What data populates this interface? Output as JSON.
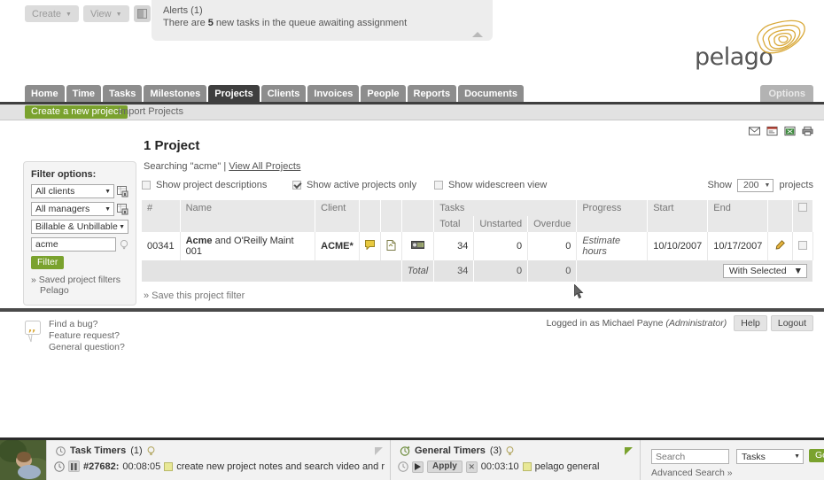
{
  "browser": {
    "create_label": "Create",
    "view_label": "View",
    "sidebar_toggle_icon": "panel-toggle-icon"
  },
  "alerts": {
    "title": "Alerts (1)",
    "message_prefix": "There are ",
    "count": "5",
    "message_suffix": " new tasks in the queue awaiting assignment",
    "collapse_icon": "collapse-triangle-icon"
  },
  "logo": {
    "text": "pelago",
    "mark_color": "#d9a93a"
  },
  "nav": {
    "tabs": [
      {
        "label": "Home",
        "active": false
      },
      {
        "label": "Time",
        "active": false
      },
      {
        "label": "Tasks",
        "active": false
      },
      {
        "label": "Milestones",
        "active": false
      },
      {
        "label": "Projects",
        "active": true
      },
      {
        "label": "Clients",
        "active": false
      },
      {
        "label": "Invoices",
        "active": false
      },
      {
        "label": "People",
        "active": false
      },
      {
        "label": "Reports",
        "active": false
      },
      {
        "label": "Documents",
        "active": false
      }
    ],
    "options_label": "Options"
  },
  "subnav": {
    "create_project_label": "Create a new project",
    "import_projects_label": "Import Projects"
  },
  "export_icons": [
    "email-icon",
    "report-icon",
    "excel-export-icon",
    "print-icon"
  ],
  "sidebar": {
    "title": "Filter options:",
    "client_select": "All clients",
    "manager_select": "All managers",
    "billable_select": "Billable & Unbillable",
    "text_filter_value": "acme",
    "text_filter_placeholder": "",
    "filter_button": "Filter",
    "saved_filters_label": "» Saved project filters",
    "saved_filter_items": [
      "Pelago"
    ]
  },
  "main": {
    "page_title": "1 Project",
    "searching_text": "Searching \"acme\"",
    "separator": "|",
    "view_all_link": "View All Projects",
    "checkboxes": [
      {
        "label": "Show project descriptions",
        "checked": false
      },
      {
        "label": "Show active projects only",
        "checked": true
      },
      {
        "label": "Show widescreen view",
        "checked": false
      }
    ],
    "show_label": "Show",
    "show_count": "200",
    "projects_label": "projects",
    "save_filter_link": "» Save this project filter",
    "with_selected_label": "With Selected"
  },
  "table": {
    "headers": {
      "id": "#",
      "name": "Name",
      "client": "Client",
      "tasks_group": "Tasks",
      "tasks_total": "Total",
      "tasks_unstarted": "Unstarted",
      "tasks_overdue": "Overdue",
      "progress": "Progress",
      "start": "Start",
      "end": "End"
    },
    "rows": [
      {
        "id": "00341",
        "name_bold": "Acme",
        "name_rest": " and O'Reilly Maint 001",
        "client": "ACME*",
        "icons": [
          "note-icon",
          "attach-file-icon",
          "presentation-icon"
        ],
        "tasks_total": "34",
        "tasks_unstarted": "0",
        "tasks_overdue": "0",
        "progress": "Estimate hours",
        "start": "10/10/2007",
        "end": "10/17/2007",
        "edit_icon": "pencil-edit-icon"
      }
    ],
    "total_row": {
      "label": "Total",
      "tasks_total": "34",
      "tasks_unstarted": "0",
      "tasks_overdue": "0"
    }
  },
  "footer": {
    "feedback_lines": [
      "Find a bug?",
      "Feature request?",
      "General question?"
    ],
    "logged_in_prefix": "Logged in as Michael Payne ",
    "logged_in_role": "(Administrator)",
    "help_label": "Help",
    "logout_label": "Logout"
  },
  "timerbar": {
    "task_timers": {
      "title": "Task Timers",
      "count": "(1)",
      "entry_id": "#27682:",
      "entry_time": "00:08:05",
      "entry_text": "create new project notes and search video and r"
    },
    "general_timers": {
      "title": "General Timers",
      "count": "(3)",
      "apply_label": "Apply",
      "entry_time": "00:03:10",
      "entry_text": "pelago general"
    },
    "search": {
      "placeholder": "Search",
      "type": "Tasks",
      "go_label": "Go",
      "advanced_label": "Advanced Search »"
    }
  }
}
